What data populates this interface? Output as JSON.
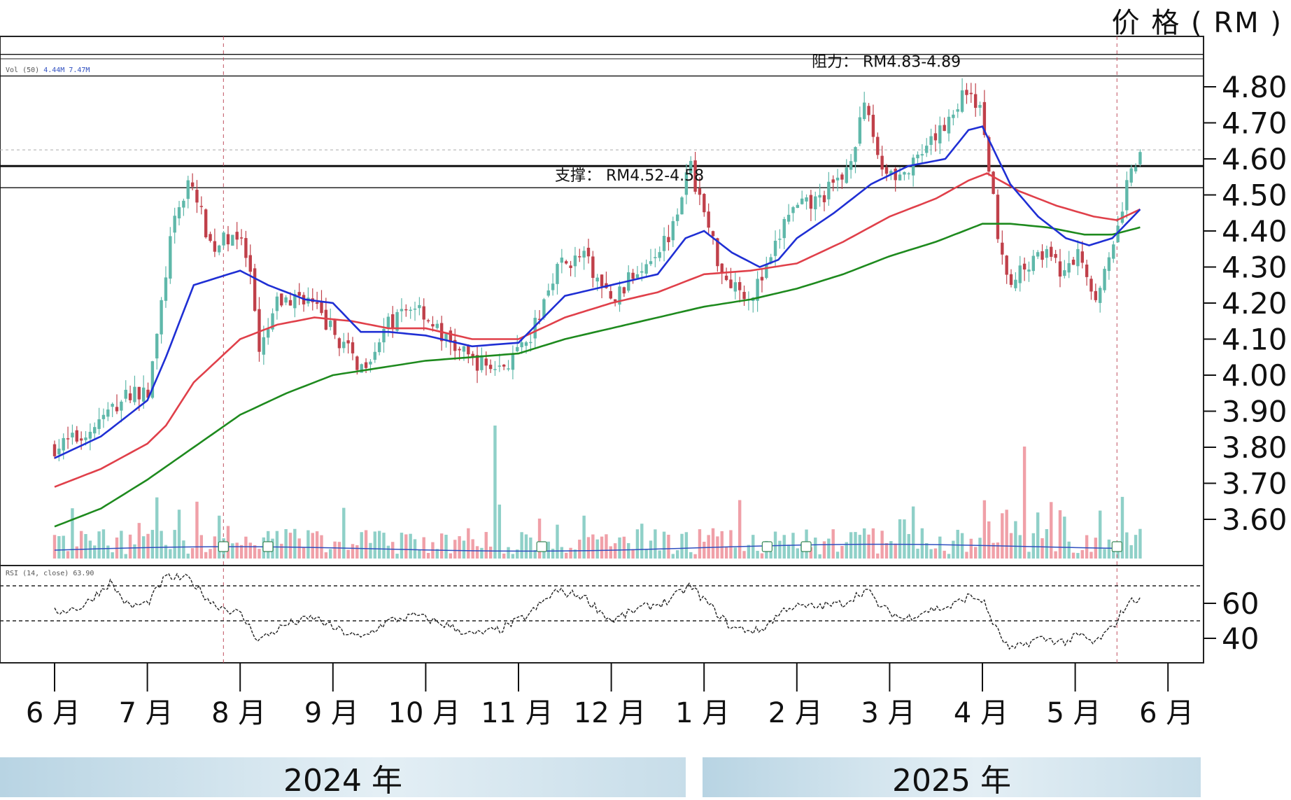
{
  "unit_label": "价 格 ( RM )",
  "year_labels": [
    "2024 年",
    "2025 年"
  ],
  "indicator_labels": {
    "rsi": "RSI (14, close)",
    "rsi_value": "63.90",
    "vol": "Vol (50)",
    "vol_values": "4.44M 7.47M"
  },
  "colors": {
    "up_candle": "#5fb8aa",
    "down_candle": "#c0404a",
    "ma_short": "#1f2fd4",
    "ma_mid": "#e0404a",
    "ma_long": "#1e8a1e",
    "vol_up": "#8fd0c8",
    "vol_down": "#f0a0a8",
    "vol_ma": "#3050c0",
    "year_bar": "#c7dde9"
  },
  "chart_data": {
    "type": "candlestick",
    "title": "",
    "xlabel": "",
    "ylabel": "价 格 ( RM )",
    "ylim": [
      3.5,
      4.93
    ],
    "y_ticks": [
      3.6,
      3.7,
      3.8,
      3.9,
      4.0,
      4.1,
      4.2,
      4.3,
      4.4,
      4.5,
      4.6,
      4.7,
      4.8
    ],
    "y_tick_labels": [
      "3.60",
      "3.70",
      "3.80",
      "3.90",
      "4.00",
      "4.10",
      "4.20",
      "4.30",
      "4.40",
      "4.50",
      "4.60",
      "4.70",
      "4.80"
    ],
    "months": [
      "6 月",
      "7 月",
      "8 月",
      "9 月",
      "10 月",
      "11 月",
      "12 月",
      "1 月",
      "2 月",
      "3 月",
      "4 月",
      "5 月",
      "6 月"
    ],
    "grid": false,
    "annotations": [
      {
        "text": "阻力： RM4.83-4.89",
        "lines": [
          4.83,
          4.89
        ]
      },
      {
        "text": "支撑： RM4.52-4.58",
        "lines": [
          4.52,
          4.58
        ]
      }
    ],
    "price_path": [
      {
        "m": 0.0,
        "p": 3.8
      },
      {
        "m": 0.3,
        "p": 3.83
      },
      {
        "m": 0.6,
        "p": 3.9
      },
      {
        "m": 0.85,
        "p": 3.96
      },
      {
        "m": 1.0,
        "p": 3.94
      },
      {
        "m": 1.1,
        "p": 4.1
      },
      {
        "m": 1.25,
        "p": 4.38
      },
      {
        "m": 1.45,
        "p": 4.55
      },
      {
        "m": 1.7,
        "p": 4.35
      },
      {
        "m": 1.95,
        "p": 4.4
      },
      {
        "m": 2.1,
        "p": 4.3
      },
      {
        "m": 2.2,
        "p": 4.05
      },
      {
        "m": 2.4,
        "p": 4.2
      },
      {
        "m": 2.7,
        "p": 4.22
      },
      {
        "m": 3.0,
        "p": 4.12
      },
      {
        "m": 3.3,
        "p": 4.02
      },
      {
        "m": 3.6,
        "p": 4.14
      },
      {
        "m": 3.9,
        "p": 4.2
      },
      {
        "m": 4.2,
        "p": 4.1
      },
      {
        "m": 4.5,
        "p": 4.04
      },
      {
        "m": 4.8,
        "p": 4.02
      },
      {
        "m": 5.1,
        "p": 4.08
      },
      {
        "m": 5.4,
        "p": 4.3
      },
      {
        "m": 5.7,
        "p": 4.33
      },
      {
        "m": 6.0,
        "p": 4.2
      },
      {
        "m": 6.3,
        "p": 4.3
      },
      {
        "m": 6.6,
        "p": 4.38
      },
      {
        "m": 6.85,
        "p": 4.58
      },
      {
        "m": 7.0,
        "p": 4.45
      },
      {
        "m": 7.2,
        "p": 4.28
      },
      {
        "m": 7.5,
        "p": 4.22
      },
      {
        "m": 7.7,
        "p": 4.3
      },
      {
        "m": 7.9,
        "p": 4.45
      },
      {
        "m": 8.2,
        "p": 4.48
      },
      {
        "m": 8.5,
        "p": 4.55
      },
      {
        "m": 8.75,
        "p": 4.75
      },
      {
        "m": 8.9,
        "p": 4.58
      },
      {
        "m": 9.15,
        "p": 4.55
      },
      {
        "m": 9.4,
        "p": 4.62
      },
      {
        "m": 9.65,
        "p": 4.72
      },
      {
        "m": 9.85,
        "p": 4.8
      },
      {
        "m": 10.0,
        "p": 4.72
      },
      {
        "m": 10.15,
        "p": 4.42
      },
      {
        "m": 10.3,
        "p": 4.25
      },
      {
        "m": 10.6,
        "p": 4.35
      },
      {
        "m": 10.9,
        "p": 4.28
      },
      {
        "m": 11.05,
        "p": 4.35
      },
      {
        "m": 11.2,
        "p": 4.22
      },
      {
        "m": 11.4,
        "p": 4.33
      },
      {
        "m": 11.55,
        "p": 4.52
      },
      {
        "m": 11.7,
        "p": 4.62
      }
    ],
    "ma_short": [
      {
        "m": 0.0,
        "p": 3.77
      },
      {
        "m": 0.5,
        "p": 3.83
      },
      {
        "m": 1.0,
        "p": 3.93
      },
      {
        "m": 1.2,
        "p": 4.05
      },
      {
        "m": 1.5,
        "p": 4.25
      },
      {
        "m": 2.0,
        "p": 4.29
      },
      {
        "m": 2.3,
        "p": 4.25
      },
      {
        "m": 2.7,
        "p": 4.21
      },
      {
        "m": 3.0,
        "p": 4.2
      },
      {
        "m": 3.3,
        "p": 4.12
      },
      {
        "m": 3.6,
        "p": 4.12
      },
      {
        "m": 4.0,
        "p": 4.11
      },
      {
        "m": 4.5,
        "p": 4.08
      },
      {
        "m": 5.0,
        "p": 4.09
      },
      {
        "m": 5.5,
        "p": 4.22
      },
      {
        "m": 6.0,
        "p": 4.25
      },
      {
        "m": 6.5,
        "p": 4.28
      },
      {
        "m": 6.8,
        "p": 4.38
      },
      {
        "m": 7.0,
        "p": 4.4
      },
      {
        "m": 7.3,
        "p": 4.34
      },
      {
        "m": 7.6,
        "p": 4.3
      },
      {
        "m": 7.8,
        "p": 4.32
      },
      {
        "m": 8.0,
        "p": 4.38
      },
      {
        "m": 8.4,
        "p": 4.45
      },
      {
        "m": 8.8,
        "p": 4.53
      },
      {
        "m": 9.2,
        "p": 4.58
      },
      {
        "m": 9.6,
        "p": 4.6
      },
      {
        "m": 9.85,
        "p": 4.68
      },
      {
        "m": 10.0,
        "p": 4.69
      },
      {
        "m": 10.3,
        "p": 4.53
      },
      {
        "m": 10.6,
        "p": 4.44
      },
      {
        "m": 10.9,
        "p": 4.38
      },
      {
        "m": 11.15,
        "p": 4.36
      },
      {
        "m": 11.4,
        "p": 4.38
      },
      {
        "m": 11.7,
        "p": 4.46
      }
    ],
    "ma_mid": [
      {
        "m": 0.0,
        "p": 3.69
      },
      {
        "m": 0.5,
        "p": 3.74
      },
      {
        "m": 1.0,
        "p": 3.81
      },
      {
        "m": 1.2,
        "p": 3.86
      },
      {
        "m": 1.5,
        "p": 3.98
      },
      {
        "m": 2.0,
        "p": 4.1
      },
      {
        "m": 2.4,
        "p": 4.14
      },
      {
        "m": 2.8,
        "p": 4.16
      },
      {
        "m": 3.2,
        "p": 4.15
      },
      {
        "m": 3.6,
        "p": 4.13
      },
      {
        "m": 4.0,
        "p": 4.13
      },
      {
        "m": 4.5,
        "p": 4.1
      },
      {
        "m": 5.0,
        "p": 4.1
      },
      {
        "m": 5.5,
        "p": 4.16
      },
      {
        "m": 6.0,
        "p": 4.2
      },
      {
        "m": 6.5,
        "p": 4.23
      },
      {
        "m": 7.0,
        "p": 4.28
      },
      {
        "m": 7.5,
        "p": 4.29
      },
      {
        "m": 8.0,
        "p": 4.31
      },
      {
        "m": 8.5,
        "p": 4.37
      },
      {
        "m": 9.0,
        "p": 4.44
      },
      {
        "m": 9.5,
        "p": 4.49
      },
      {
        "m": 9.85,
        "p": 4.54
      },
      {
        "m": 10.05,
        "p": 4.56
      },
      {
        "m": 10.4,
        "p": 4.51
      },
      {
        "m": 10.8,
        "p": 4.47
      },
      {
        "m": 11.2,
        "p": 4.44
      },
      {
        "m": 11.45,
        "p": 4.43
      },
      {
        "m": 11.7,
        "p": 4.46
      }
    ],
    "ma_long": [
      {
        "m": 0.0,
        "p": 3.58
      },
      {
        "m": 0.5,
        "p": 3.63
      },
      {
        "m": 1.0,
        "p": 3.71
      },
      {
        "m": 1.5,
        "p": 3.8
      },
      {
        "m": 2.0,
        "p": 3.89
      },
      {
        "m": 2.5,
        "p": 3.95
      },
      {
        "m": 3.0,
        "p": 4.0
      },
      {
        "m": 3.5,
        "p": 4.02
      },
      {
        "m": 4.0,
        "p": 4.04
      },
      {
        "m": 4.5,
        "p": 4.05
      },
      {
        "m": 5.0,
        "p": 4.06
      },
      {
        "m": 5.5,
        "p": 4.1
      },
      {
        "m": 6.0,
        "p": 4.13
      },
      {
        "m": 6.5,
        "p": 4.16
      },
      {
        "m": 7.0,
        "p": 4.19
      },
      {
        "m": 7.5,
        "p": 4.21
      },
      {
        "m": 8.0,
        "p": 4.24
      },
      {
        "m": 8.5,
        "p": 4.28
      },
      {
        "m": 9.0,
        "p": 4.33
      },
      {
        "m": 9.5,
        "p": 4.37
      },
      {
        "m": 10.0,
        "p": 4.42
      },
      {
        "m": 10.3,
        "p": 4.42
      },
      {
        "m": 10.7,
        "p": 4.41
      },
      {
        "m": 11.1,
        "p": 4.39
      },
      {
        "m": 11.4,
        "p": 4.39
      },
      {
        "m": 11.7,
        "p": 4.41
      }
    ],
    "rsi": {
      "ticks": [
        60,
        40
      ],
      "tick_labels": [
        "60",
        "40"
      ],
      "range": [
        30,
        80
      ],
      "levels": [
        70,
        50
      ],
      "path": [
        {
          "m": 0.0,
          "v": 55
        },
        {
          "m": 0.3,
          "v": 58
        },
        {
          "m": 0.6,
          "v": 72
        },
        {
          "m": 0.8,
          "v": 58
        },
        {
          "m": 1.0,
          "v": 60
        },
        {
          "m": 1.2,
          "v": 75
        },
        {
          "m": 1.45,
          "v": 74
        },
        {
          "m": 1.7,
          "v": 60
        },
        {
          "m": 2.0,
          "v": 54
        },
        {
          "m": 2.2,
          "v": 39
        },
        {
          "m": 2.5,
          "v": 48
        },
        {
          "m": 2.8,
          "v": 52
        },
        {
          "m": 3.0,
          "v": 46
        },
        {
          "m": 3.3,
          "v": 40
        },
        {
          "m": 3.6,
          "v": 50
        },
        {
          "m": 3.9,
          "v": 53
        },
        {
          "m": 4.2,
          "v": 48
        },
        {
          "m": 4.5,
          "v": 42
        },
        {
          "m": 4.8,
          "v": 45
        },
        {
          "m": 5.1,
          "v": 53
        },
        {
          "m": 5.4,
          "v": 67
        },
        {
          "m": 5.7,
          "v": 64
        },
        {
          "m": 6.0,
          "v": 50
        },
        {
          "m": 6.3,
          "v": 57
        },
        {
          "m": 6.6,
          "v": 61
        },
        {
          "m": 6.85,
          "v": 70
        },
        {
          "m": 7.0,
          "v": 62
        },
        {
          "m": 7.3,
          "v": 46
        },
        {
          "m": 7.6,
          "v": 44
        },
        {
          "m": 7.9,
          "v": 58
        },
        {
          "m": 8.2,
          "v": 58
        },
        {
          "m": 8.5,
          "v": 60
        },
        {
          "m": 8.75,
          "v": 68
        },
        {
          "m": 8.9,
          "v": 58
        },
        {
          "m": 9.15,
          "v": 51
        },
        {
          "m": 9.4,
          "v": 56
        },
        {
          "m": 9.65,
          "v": 58
        },
        {
          "m": 9.85,
          "v": 64
        },
        {
          "m": 10.0,
          "v": 62
        },
        {
          "m": 10.15,
          "v": 45
        },
        {
          "m": 10.3,
          "v": 33
        },
        {
          "m": 10.6,
          "v": 40
        },
        {
          "m": 10.9,
          "v": 38
        },
        {
          "m": 11.05,
          "v": 42
        },
        {
          "m": 11.2,
          "v": 37
        },
        {
          "m": 11.4,
          "v": 46
        },
        {
          "m": 11.55,
          "v": 59
        },
        {
          "m": 11.7,
          "v": 64
        }
      ]
    }
  }
}
